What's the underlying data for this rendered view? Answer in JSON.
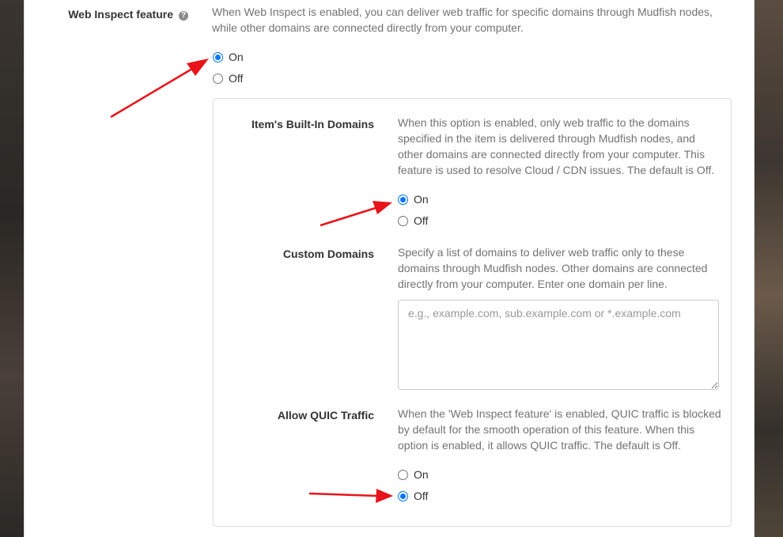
{
  "web_inspect": {
    "label": "Web Inspect feature",
    "help_icon": "question-circle-icon",
    "help": "When Web Inspect is enabled, you can deliver web traffic for specific domains through Mudfish nodes, while other domains are connected directly from your computer.",
    "options": [
      {
        "label": "On",
        "checked": true
      },
      {
        "label": "Off",
        "checked": false
      }
    ]
  },
  "builtin_domains": {
    "label": "Item's Built-In Domains",
    "help": "When this option is enabled, only web traffic to the domains specified in the item is delivered through Mudfish nodes, and other domains are connected directly from your computer. This feature is used to resolve Cloud / CDN issues. The default is Off.",
    "options": [
      {
        "label": "On",
        "checked": true
      },
      {
        "label": "Off",
        "checked": false
      }
    ]
  },
  "custom_domains": {
    "label": "Custom Domains",
    "help": "Specify a list of domains to deliver web traffic only to these domains through Mudfish nodes. Other domains are connected directly from your computer. Enter one domain per line.",
    "placeholder": "e.g., example.com, sub.example.com or *.example.com",
    "value": ""
  },
  "allow_quic": {
    "label": "Allow QUIC Traffic",
    "help": "When the 'Web Inspect feature' is enabled, QUIC traffic is blocked by default for the smooth operation of this feature. When this option is enabled, it allows QUIC traffic. The default is Off.",
    "options": [
      {
        "label": "On",
        "checked": false
      },
      {
        "label": "Off",
        "checked": true
      }
    ]
  },
  "annotation_color": "#e8141b",
  "radio_accent": "#0075ff"
}
